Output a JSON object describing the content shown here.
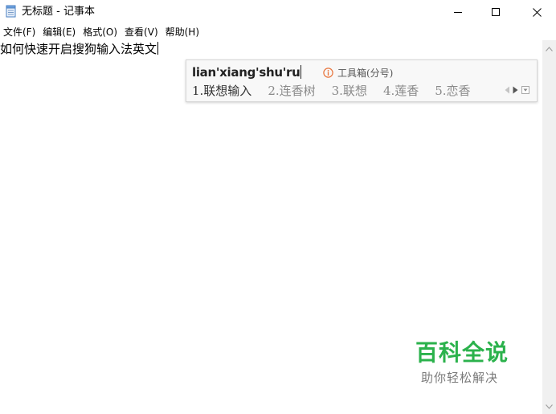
{
  "window": {
    "title": "无标题 - 记事本",
    "app_icon": "notepad-icon",
    "controls": {
      "minimize_icon": "minimize-icon",
      "maximize_icon": "maximize-icon",
      "close_icon": "close-icon"
    }
  },
  "menubar": {
    "items": [
      {
        "label": "文件(F)"
      },
      {
        "label": "编辑(E)"
      },
      {
        "label": "格式(O)"
      },
      {
        "label": "查看(V)"
      },
      {
        "label": "帮助(H)"
      }
    ]
  },
  "editor": {
    "text": "如何快速开启搜狗输入法英文"
  },
  "ime": {
    "pinyin": "lian'xiang'shu'ru",
    "toolbox": "工具箱(分号)",
    "toolbox_icon": "info-icon",
    "candidates": [
      {
        "label": "1.联想输入"
      },
      {
        "label": "2.连香树"
      },
      {
        "label": "3.联想"
      },
      {
        "label": "4.莲香"
      },
      {
        "label": "5.恋香"
      }
    ],
    "nav": {
      "prev_icon": "prev-page-icon",
      "next_icon": "next-page-icon",
      "expand_icon": "expand-icon"
    }
  },
  "watermark": {
    "title": "百科全说",
    "subtitle": "助你轻松解决"
  },
  "colors": {
    "watermark_green": "#2bb24c",
    "candidate_highlight": "#333333",
    "candidate_normal": "#8a8a8a"
  }
}
